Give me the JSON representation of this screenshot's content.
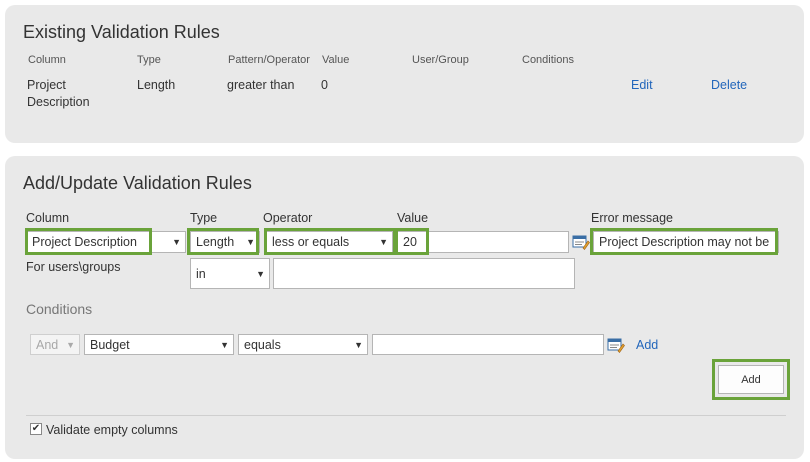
{
  "existing": {
    "title": "Existing Validation Rules",
    "headers": [
      "Column",
      "Type",
      "Pattern/Operator",
      "Value",
      "User/Group",
      "Conditions"
    ],
    "rows": [
      {
        "column_line1": "Project",
        "column_line2": "Description",
        "type": "Length",
        "operator": "greater than",
        "value": "0",
        "user_group": "",
        "conditions": "",
        "edit_label": "Edit",
        "delete_label": "Delete"
      }
    ]
  },
  "add_update": {
    "title": "Add/Update Validation Rules",
    "labels": {
      "column": "Column",
      "type": "Type",
      "operator": "Operator",
      "value": "Value",
      "error_message": "Error message",
      "for_users": "For users\\groups",
      "conditions": "Conditions"
    },
    "column_select": "Project Description",
    "type_select": "Length",
    "operator_select": "less or equals",
    "value_input": "20",
    "error_message_input": "Project Description may not be",
    "users_operator_select": "in",
    "users_input": "",
    "condition": {
      "logic_select": "And",
      "field_select": "Budget",
      "operator_select": "equals",
      "value_input": "",
      "add_link": "Add"
    },
    "add_button": "Add",
    "validate_empty_label": "Validate empty columns",
    "validate_empty_checked": true
  },
  "colors": {
    "highlight": "#6aa33a",
    "link": "#2266bb",
    "panel_bg": "#e9e9e9"
  }
}
